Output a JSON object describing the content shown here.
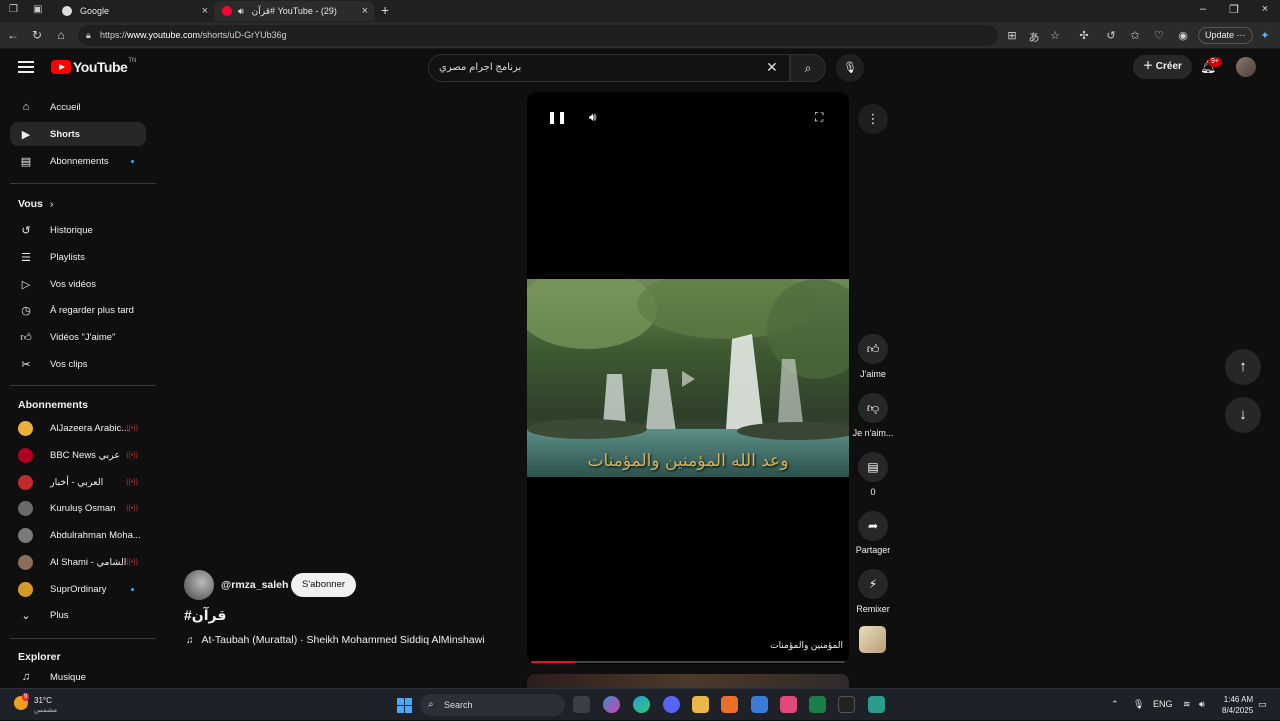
{
  "browser": {
    "tabs": [
      {
        "title": "Google"
      },
      {
        "title": "YouTube - (29) #قرآن"
      }
    ],
    "url_prefix": "https://",
    "url_host": "www.youtube.com",
    "url_path": "/shorts/uD-GrYUb36g",
    "update_label": "Update"
  },
  "header": {
    "logo": "YouTube",
    "logo_tm": "TN",
    "search_value": "برنامج اجرام مصري",
    "create_label": "Créer",
    "notif_badge": "9+"
  },
  "sidebar": {
    "main": [
      {
        "label": "Accueil",
        "icon": "home-icon"
      },
      {
        "label": "Shorts",
        "icon": "shorts-icon",
        "active": true
      },
      {
        "label": "Abonnements",
        "icon": "subscriptions-icon"
      }
    ],
    "you_heading": "Vous",
    "you": [
      {
        "label": "Historique",
        "icon": "history-icon"
      },
      {
        "label": "Playlists",
        "icon": "playlists-icon"
      },
      {
        "label": "Vos vidéos",
        "icon": "your-videos-icon"
      },
      {
        "label": "À regarder plus tard",
        "icon": "watch-later-icon"
      },
      {
        "label": "Vidéos \"J'aime\"",
        "icon": "liked-videos-icon"
      },
      {
        "label": "Vos clips",
        "icon": "clips-icon"
      }
    ],
    "subs_heading": "Abonnements",
    "subs": [
      {
        "label": "AlJazeera Arabic...",
        "color": "#e8b23a",
        "status": "live"
      },
      {
        "label": "BBC News عربي",
        "color": "#b0001e",
        "status": "live"
      },
      {
        "label": "العربي - أخبار",
        "color": "#c02a2a",
        "status": "live"
      },
      {
        "label": "Kuruluş Osman",
        "color": "#6a6a6a",
        "status": "live"
      },
      {
        "label": "Abdulrahman Moha...",
        "color": "#7a7a7a",
        "status": ""
      },
      {
        "label": "Al Shami - الشامي",
        "color": "#8a6e5a",
        "status": "live"
      },
      {
        "label": "SuprOrdinary",
        "color": "#d49b2a",
        "status": "dot"
      }
    ],
    "more_label": "Plus",
    "explore_heading": "Explorer",
    "explore": [
      {
        "label": "Musique",
        "icon": "music-icon"
      }
    ]
  },
  "player": {
    "caption": "وعد الله المؤمنين والمؤمنات",
    "subtitle": "المؤمنين والمؤمنات",
    "progress": 0.14
  },
  "actions": {
    "like_label": "J'aime",
    "dislike_label": "Je n'aim...",
    "comments_count": "0",
    "share_label": "Partager",
    "remix_label": "Remixer"
  },
  "short": {
    "channel": "@rmza_saleh",
    "subscribe_label": "S'abonner",
    "title": "#قرآن",
    "music": "At-Taubah (Murattal) · Sheikh Mohammed Siddiq AlMinshawi"
  },
  "taskbar": {
    "temp": "31°C",
    "weather_text": "مشمس",
    "weather_badge": "9",
    "search_placeholder": "Search",
    "lang": "ENG",
    "time": "1:46 AM",
    "date": "8/4/2025"
  },
  "colors": {
    "accent_red": "#ff0033",
    "youtube_red": "#ff0000"
  }
}
